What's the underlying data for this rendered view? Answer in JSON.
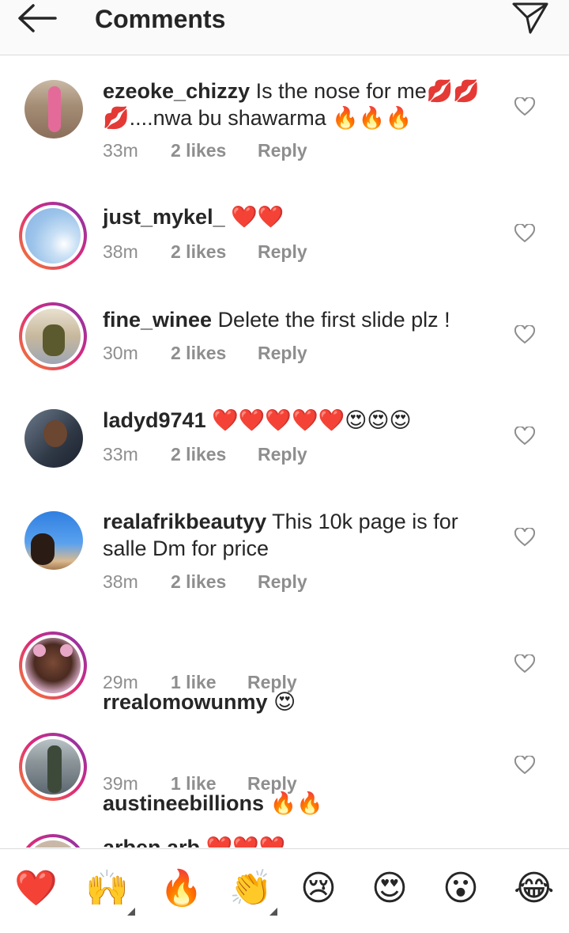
{
  "header": {
    "title": "Comments",
    "back_icon": "arrow-left-icon",
    "send_icon": "paper-plane-icon"
  },
  "comments": [
    {
      "username": "ezeoke_chizzy",
      "text": "Is the nose for me💋💋💋....nwa bu shawarma 🔥🔥🔥",
      "time": "33m",
      "likes": "2 likes",
      "reply": "Reply"
    },
    {
      "username": "just_mykel_",
      "text": "❤️❤️",
      "time": "38m",
      "likes": "2 likes",
      "reply": "Reply"
    },
    {
      "username": "fine_winee",
      "text": "Delete the first slide  plz !",
      "time": "30m",
      "likes": "2 likes",
      "reply": "Reply"
    },
    {
      "username": "ladyd9741",
      "text": "❤️❤️❤️❤️❤️😍😍😍",
      "time": "33m",
      "likes": "2 likes",
      "reply": "Reply"
    },
    {
      "username": "realafrikbeautyy",
      "text": "This 10k page is for salle Dm for price",
      "time": "38m",
      "likes": "2 likes",
      "reply": "Reply"
    },
    {
      "username": "rrealomowunmy",
      "text": "😍",
      "time": "29m",
      "likes": "1 like",
      "reply": "Reply"
    },
    {
      "username": "austineebillions",
      "text": "🔥🔥",
      "time": "39m",
      "likes": "1 like",
      "reply": "Reply"
    },
    {
      "username": "arben.arb",
      "text": "❤️❤️❤️",
      "time": "",
      "likes": "",
      "reply": ""
    }
  ],
  "emoji_bar": [
    "❤️",
    "🙌",
    "🔥",
    "👏",
    "😢",
    "😍",
    "😮",
    "😂"
  ],
  "colors": {
    "ring_start": "#f58529",
    "ring_mid": "#dd2a7b",
    "ring_end": "#8134af",
    "meta_gray": "#8e8e8e"
  }
}
